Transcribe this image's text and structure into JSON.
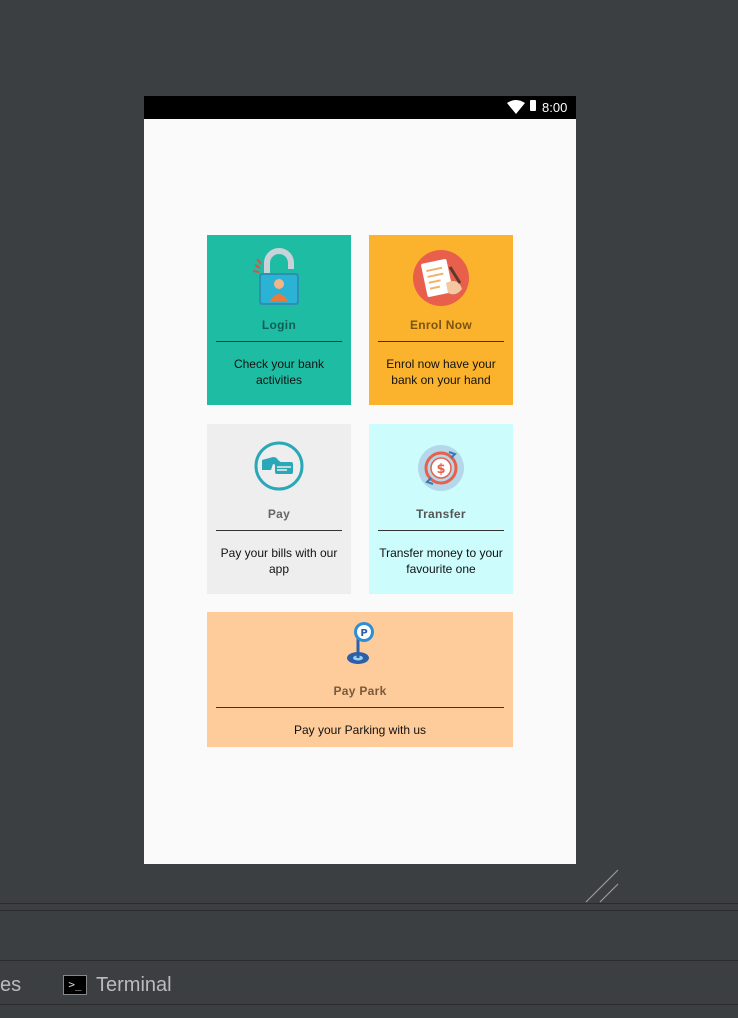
{
  "statusbar": {
    "time": "8:00"
  },
  "cards": {
    "login": {
      "title": "Login",
      "desc": "Check your bank activities",
      "bg": "#1fbca4"
    },
    "enrol": {
      "title": "Enrol Now",
      "desc": "Enrol now have your bank on your hand",
      "bg": "#fbb32e"
    },
    "pay": {
      "title": "Pay",
      "desc": "Pay your bills with our app",
      "bg": "#eeeeee"
    },
    "transfer": {
      "title": "Transfer",
      "desc": "Transfer money to your favourite one",
      "bg": "#ccfcfc"
    },
    "paypark": {
      "title": "Pay Park",
      "desc": "Pay your Parking with us",
      "bg": "#fdcc9a"
    }
  },
  "ide": {
    "left_tab_fragment": "es",
    "terminal_label": "Terminal",
    "terminal_icon_glyph": ">_"
  }
}
